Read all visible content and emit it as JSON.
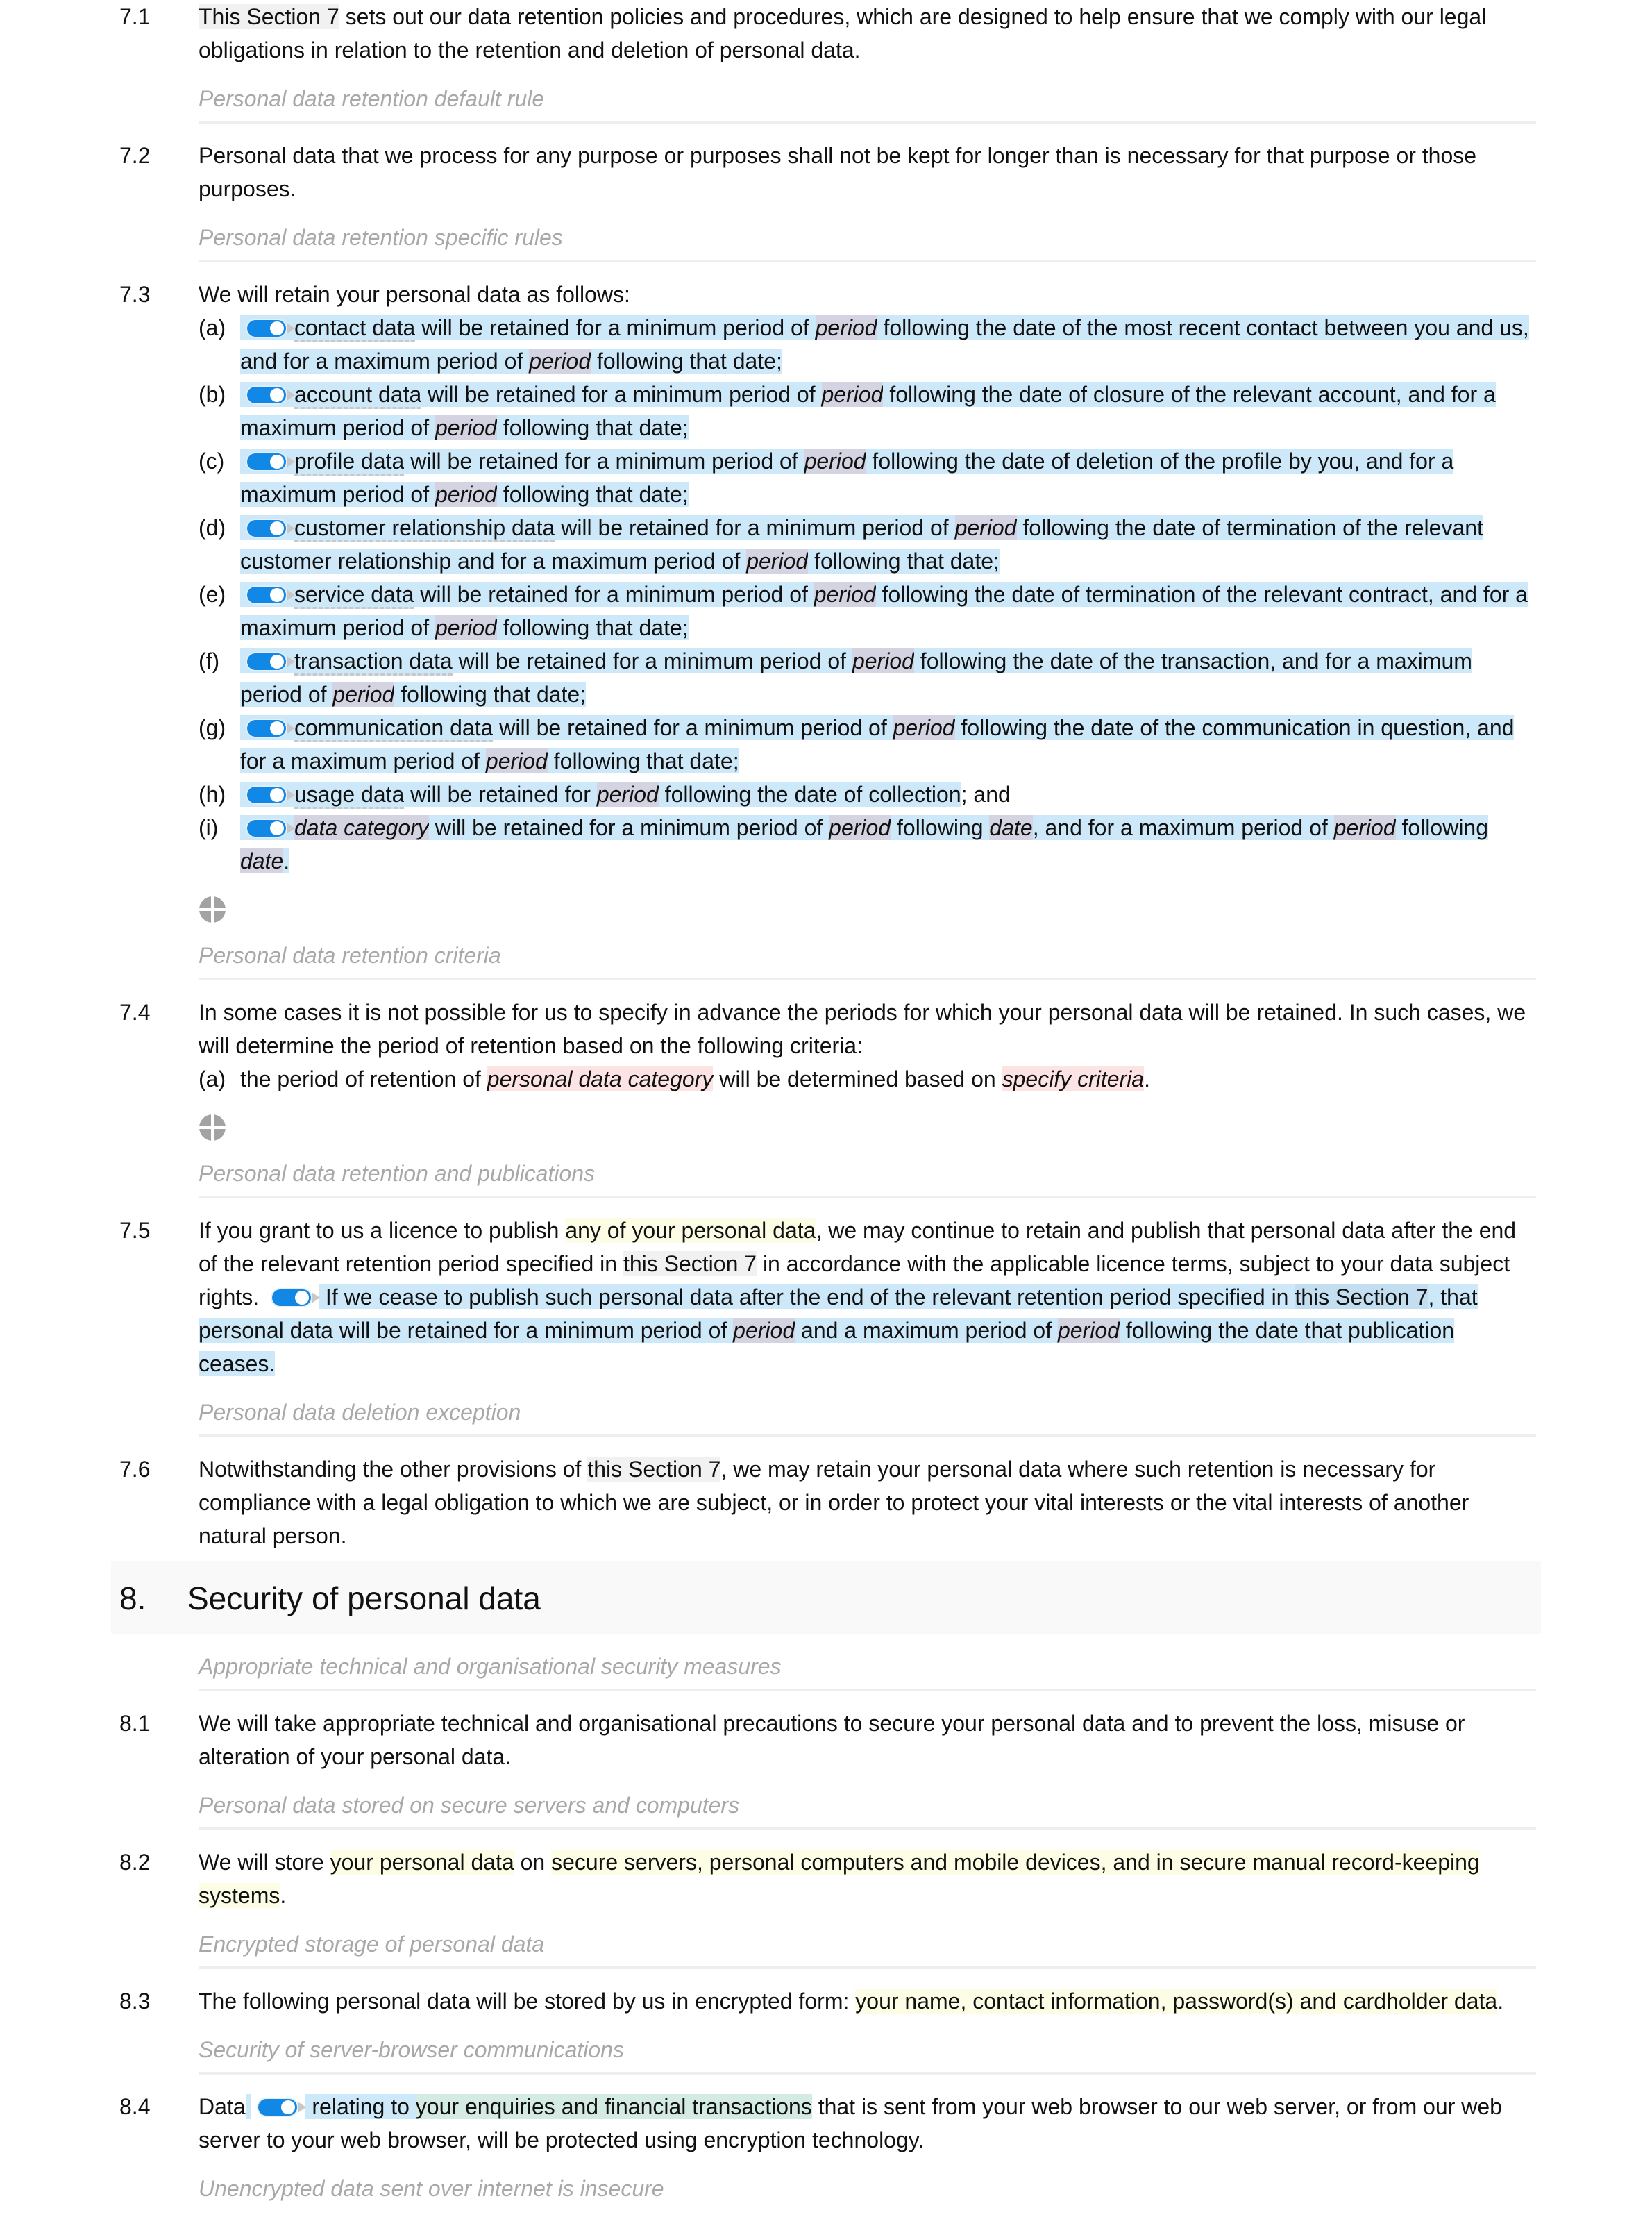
{
  "colors": {
    "optional_highlight": "#cde8f9",
    "variable_highlight": "#d3d3e2",
    "reference_highlight": "#f1f1f1",
    "placeholder_highlight": "#fdfde6",
    "required_highlight": "#fce4e4",
    "linked_highlight": "#d4ebe3",
    "toggle_on": "#1288e6",
    "subheading_text": "#a8a8a8"
  },
  "blocks": [
    {
      "type": "clause",
      "num": "7.1",
      "segments": [
        {
          "t": "ref",
          "v": "This Section 7"
        },
        {
          "t": "text",
          "v": " sets out our data retention policies and procedures, which are designed to help ensure that we comply with our legal obligations in relation to the retention and deletion of personal data."
        }
      ]
    },
    {
      "type": "subheading",
      "text": "Personal data retention default rule"
    },
    {
      "type": "clause",
      "num": "7.2",
      "segments": [
        {
          "t": "text",
          "v": "Personal data that we process for any purpose or purposes shall not be kept for longer than is necessary for that purpose or those purposes."
        }
      ]
    },
    {
      "type": "subheading",
      "text": "Personal data retention specific rules"
    },
    {
      "type": "clause",
      "num": "7.3",
      "segments": [
        {
          "t": "text",
          "v": "We will retain your personal data as follows:"
        }
      ],
      "subitems": [
        {
          "letter": "(a)",
          "toggle": "on",
          "segments": [
            {
              "t": "opt-dash",
              "v": "contact data"
            },
            {
              "t": "opt",
              "v": " will be retained for a minimum period of "
            },
            {
              "t": "var",
              "v": "period"
            },
            {
              "t": "opt",
              "v": " following the date of the most recent contact between you and us, and for a maximum period of "
            },
            {
              "t": "var",
              "v": "period"
            },
            {
              "t": "opt",
              "v": " following that date;"
            }
          ]
        },
        {
          "letter": "(b)",
          "toggle": "on",
          "segments": [
            {
              "t": "opt-dash",
              "v": "account data"
            },
            {
              "t": "opt",
              "v": " will be retained for a minimum period of "
            },
            {
              "t": "var",
              "v": "period"
            },
            {
              "t": "opt",
              "v": " following the date of closure of the relevant account, and for a maximum period of "
            },
            {
              "t": "var",
              "v": "period"
            },
            {
              "t": "opt",
              "v": " following that date;"
            }
          ]
        },
        {
          "letter": "(c)",
          "toggle": "on",
          "segments": [
            {
              "t": "opt-dash",
              "v": "profile data"
            },
            {
              "t": "opt",
              "v": " will be retained for a minimum period of "
            },
            {
              "t": "var",
              "v": "period"
            },
            {
              "t": "opt",
              "v": " following the date of deletion of the profile by you, and for a maximum period of "
            },
            {
              "t": "var",
              "v": "period"
            },
            {
              "t": "opt",
              "v": " following that date;"
            }
          ]
        },
        {
          "letter": "(d)",
          "toggle": "on",
          "segments": [
            {
              "t": "opt-dash",
              "v": "customer relationship data"
            },
            {
              "t": "opt",
              "v": " will be retained for a minimum period of "
            },
            {
              "t": "var",
              "v": "period"
            },
            {
              "t": "opt",
              "v": " following the date of termination of the relevant customer relationship and for a maximum period of "
            },
            {
              "t": "var",
              "v": "period"
            },
            {
              "t": "opt",
              "v": " following that date;"
            }
          ]
        },
        {
          "letter": "(e)",
          "toggle": "on",
          "segments": [
            {
              "t": "opt-dash",
              "v": "service data"
            },
            {
              "t": "opt",
              "v": " will be retained for a minimum period of "
            },
            {
              "t": "var",
              "v": "period"
            },
            {
              "t": "opt",
              "v": " following the date of termination of the relevant contract, and for a maximum period of "
            },
            {
              "t": "var",
              "v": "period"
            },
            {
              "t": "opt",
              "v": " following that date;"
            }
          ]
        },
        {
          "letter": "(f)",
          "toggle": "on",
          "segments": [
            {
              "t": "opt-dash",
              "v": "transaction data"
            },
            {
              "t": "opt",
              "v": " will be retained for a minimum period of "
            },
            {
              "t": "var",
              "v": "period"
            },
            {
              "t": "opt",
              "v": " following the date of the transaction, and for a maximum period of "
            },
            {
              "t": "var",
              "v": "period"
            },
            {
              "t": "opt",
              "v": " following that date;"
            }
          ]
        },
        {
          "letter": "(g)",
          "toggle": "on",
          "segments": [
            {
              "t": "opt-dash",
              "v": "communication data"
            },
            {
              "t": "opt",
              "v": " will be retained for a minimum period of "
            },
            {
              "t": "var",
              "v": "period"
            },
            {
              "t": "opt",
              "v": " following the date of the communication in question, and for a maximum period of "
            },
            {
              "t": "var",
              "v": "period"
            },
            {
              "t": "opt",
              "v": " following that date;"
            }
          ]
        },
        {
          "letter": "(h)",
          "toggle": "on",
          "segments": [
            {
              "t": "opt-dash",
              "v": "usage data"
            },
            {
              "t": "opt",
              "v": " will be retained for "
            },
            {
              "t": "var",
              "v": "period"
            },
            {
              "t": "opt",
              "v": " following the date of collection"
            },
            {
              "t": "text",
              "v": "; and"
            }
          ]
        },
        {
          "letter": "(i)",
          "toggle": "on",
          "segments": [
            {
              "t": "var",
              "v": "data category"
            },
            {
              "t": "opt",
              "v": " will be retained for a minimum period of "
            },
            {
              "t": "var",
              "v": "period"
            },
            {
              "t": "opt",
              "v": " following "
            },
            {
              "t": "var",
              "v": "date"
            },
            {
              "t": "opt",
              "v": ", and for a maximum period of "
            },
            {
              "t": "var",
              "v": "period"
            },
            {
              "t": "opt",
              "v": " following "
            },
            {
              "t": "var",
              "v": "date"
            },
            {
              "t": "opt",
              "v": "."
            }
          ]
        }
      ]
    },
    {
      "type": "handle",
      "icon": "add-item-handle-icon"
    },
    {
      "type": "subheading",
      "text": "Personal data retention criteria"
    },
    {
      "type": "clause",
      "num": "7.4",
      "segments": [
        {
          "t": "text",
          "v": "In some cases it is not possible for us to specify in advance the periods for which your personal data will be retained. In such cases, we will determine the period of retention based on the following criteria:"
        }
      ],
      "inline_subitems": [
        {
          "letter": "(a)",
          "segments": [
            {
              "t": "text",
              "v": "the period of retention of "
            },
            {
              "t": "pink",
              "v": "personal data category"
            },
            {
              "t": "text",
              "v": " will be determined based on "
            },
            {
              "t": "pink",
              "v": "specify criteria"
            },
            {
              "t": "text",
              "v": "."
            }
          ]
        }
      ]
    },
    {
      "type": "handle",
      "icon": "add-item-handle-icon"
    },
    {
      "type": "subheading",
      "text": "Personal data retention and publications"
    },
    {
      "type": "clause",
      "num": "7.5",
      "segments": [
        {
          "t": "text",
          "v": "If you grant to us a licence to publish "
        },
        {
          "t": "yel",
          "v": "any of your personal data"
        },
        {
          "t": "text",
          "v": ", we may continue to retain and publish that personal data after the end of the relevant retention period specified in "
        },
        {
          "t": "ref",
          "v": "this Section 7"
        },
        {
          "t": "text",
          "v": " in accordance with the applicable licence terms, subject to your data subject rights. "
        },
        {
          "t": "toggle",
          "v": "on"
        },
        {
          "t": "opt",
          "v": " If we cease to publish such personal data after the end of the relevant retention period specified in "
        },
        {
          "t": "opt-ref",
          "v": "this Section 7"
        },
        {
          "t": "opt",
          "v": ", that personal data will be retained for a minimum period of "
        },
        {
          "t": "var",
          "v": "period"
        },
        {
          "t": "opt",
          "v": " and a maximum period of "
        },
        {
          "t": "var",
          "v": "period"
        },
        {
          "t": "opt",
          "v": " following the date that publication ceases."
        }
      ]
    },
    {
      "type": "subheading",
      "text": "Personal data deletion exception"
    },
    {
      "type": "clause",
      "num": "7.6",
      "segments": [
        {
          "t": "text",
          "v": "Notwithstanding the other provisions of "
        },
        {
          "t": "ref",
          "v": "this Section 7"
        },
        {
          "t": "text",
          "v": ", we may retain your personal data where such retention is necessary for compliance with a legal obligation to which we are subject, or in order to protect your vital interests or the vital interests of another natural person."
        }
      ]
    },
    {
      "type": "section",
      "num": "8.",
      "title": "Security of personal data"
    },
    {
      "type": "subheading",
      "text": "Appropriate technical and organisational security measures"
    },
    {
      "type": "clause",
      "num": "8.1",
      "segments": [
        {
          "t": "text",
          "v": "We will take appropriate technical and organisational precautions to secure your personal data and to prevent the loss, misuse or alteration of your personal data."
        }
      ]
    },
    {
      "type": "subheading",
      "text": "Personal data stored on secure servers and computers"
    },
    {
      "type": "clause",
      "num": "8.2",
      "segments": [
        {
          "t": "text",
          "v": "We will store "
        },
        {
          "t": "yel",
          "v": "your personal data"
        },
        {
          "t": "text",
          "v": " on "
        },
        {
          "t": "yel",
          "v": "secure servers, personal computers and mobile devices, and in secure manual record-keeping systems"
        },
        {
          "t": "text",
          "v": "."
        }
      ]
    },
    {
      "type": "subheading",
      "text": "Encrypted storage of personal data"
    },
    {
      "type": "clause",
      "num": "8.3",
      "segments": [
        {
          "t": "text",
          "v": "The following personal data will be stored by us in encrypted form: "
        },
        {
          "t": "yel",
          "v": "your name, contact information, password(s) and cardholder data"
        },
        {
          "t": "text",
          "v": "."
        }
      ]
    },
    {
      "type": "subheading",
      "text": "Security of server-browser communications"
    },
    {
      "type": "clause",
      "num": "8.4",
      "segments": [
        {
          "t": "text",
          "v": "Data"
        },
        {
          "t": "opt",
          "v": " "
        },
        {
          "t": "toggle",
          "v": "on"
        },
        {
          "t": "opt",
          "v": " relating to "
        },
        {
          "t": "grn",
          "v": "your enquiries and financial transactions"
        },
        {
          "t": "text",
          "v": " that is sent from your web browser to our web server, or from our web server to your web browser, will be protected using encryption technology."
        }
      ]
    },
    {
      "type": "subheading",
      "text": "Unencrypted data sent over internet is insecure",
      "no_rule": true
    }
  ]
}
